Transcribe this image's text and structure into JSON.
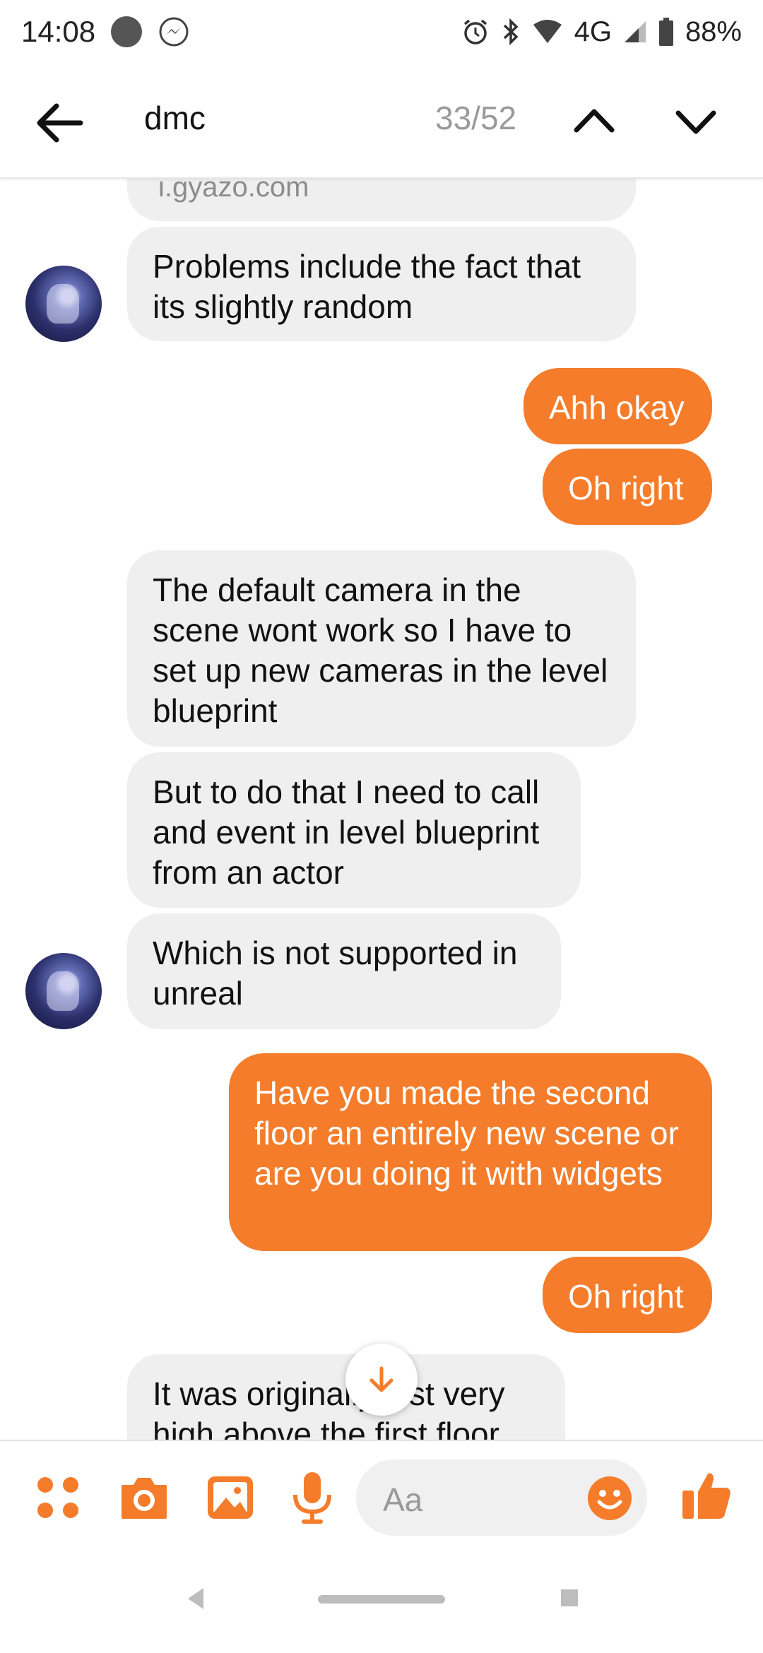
{
  "status_bar": {
    "time": "14:08",
    "network": "4G",
    "battery": "88%",
    "icons": [
      "notification-dot-icon",
      "messenger-icon",
      "alarm-icon",
      "bluetooth-icon",
      "wifi-icon",
      "signal-icon",
      "battery-icon"
    ]
  },
  "search": {
    "term": "dmc",
    "counter": "33/52"
  },
  "messages": [
    {
      "side": "in",
      "text": "i.gyazo.com"
    },
    {
      "side": "in",
      "text": "Problems include the fact that its slightly random"
    },
    {
      "side": "out",
      "text": "Ahh okay"
    },
    {
      "side": "out",
      "text": "Oh right"
    },
    {
      "side": "in",
      "text": "The default camera in the scene wont work so I have to set up new cameras in the level blueprint"
    },
    {
      "side": "in",
      "text": "But to do that I need to call and event in level blueprint from an actor"
    },
    {
      "side": "in",
      "text": "Which is not supported in unreal"
    },
    {
      "side": "out",
      "text": "Have you made the second floor an entirely new scene or are you doing it with widgets"
    },
    {
      "side": "out",
      "text": "Oh right"
    },
    {
      "side": "in",
      "text": "It was originally just very high above the first floor"
    }
  ],
  "composer": {
    "placeholder": "Aa"
  },
  "colors": {
    "accent": "#f47c2a",
    "incoming_bubble": "#efefef"
  }
}
